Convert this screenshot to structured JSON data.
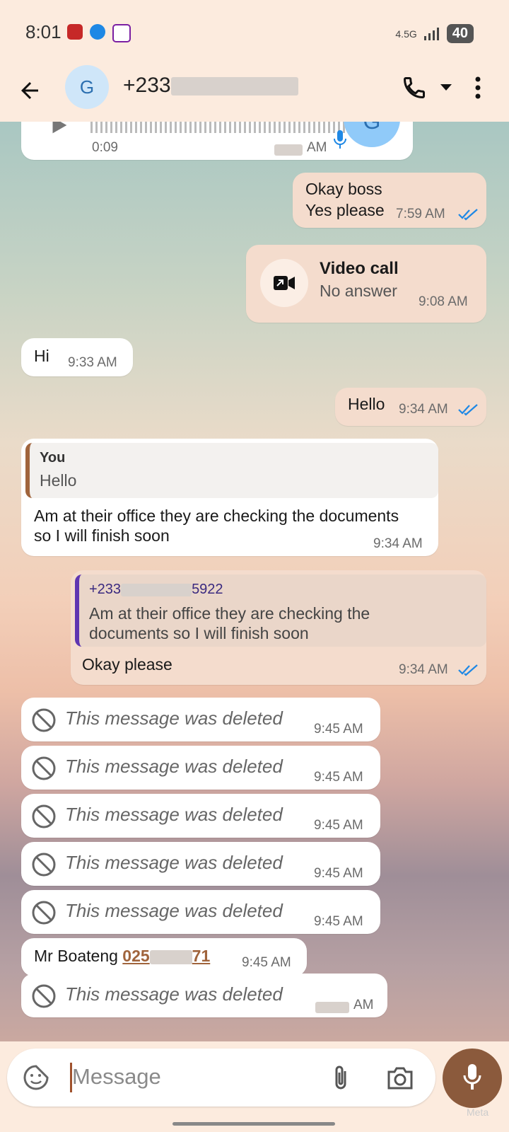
{
  "status_bar": {
    "time": "8:01",
    "network": "4.5G",
    "battery": "40"
  },
  "header": {
    "avatar_letter": "G",
    "contact_prefix": "+233"
  },
  "messages": {
    "voice": {
      "duration": "0:09",
      "time_suffix": "AM",
      "avatar_letter": "G"
    },
    "okay_boss": {
      "line1": "Okay boss",
      "line2": "Yes please",
      "time": "7:59 AM"
    },
    "video_call": {
      "title": "Video call",
      "subtitle": "No answer",
      "time": "9:08 AM"
    },
    "hi": {
      "text": "Hi",
      "time": "9:33 AM"
    },
    "hello": {
      "text": "Hello",
      "time": "9:34 AM"
    },
    "reply_in": {
      "quote_author": "You",
      "quote_text": "Hello",
      "line1": "Am at their office they are checking the documents",
      "line2": "so I will finish soon",
      "time": "9:34 AM"
    },
    "reply_out": {
      "quote_author_prefix": "+233",
      "quote_author_suffix": "5922",
      "quote_line1": "Am at their office they are checking the",
      "quote_line2": "documents so I will finish soon",
      "text": "Okay please",
      "time": "9:34 AM"
    },
    "deleted_text": "This message was deleted",
    "deleted_time": "9:45 AM",
    "boateng": {
      "name": "Mr Boateng ",
      "phone_prefix": "025",
      "phone_suffix": "71",
      "time": "9:45 AM"
    },
    "last_deleted_time_suffix": "AM"
  },
  "composer": {
    "placeholder": "Message"
  },
  "watermark": "Meta"
}
